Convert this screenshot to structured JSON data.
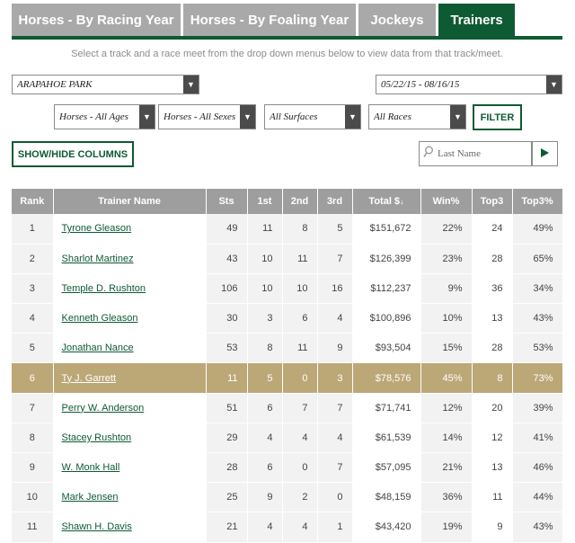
{
  "tabs": [
    {
      "label": "Horses - By Racing Year",
      "active": false
    },
    {
      "label": "Horses - By Foaling Year",
      "active": false
    },
    {
      "label": "Jockeys",
      "active": false
    },
    {
      "label": "Trainers",
      "active": true
    }
  ],
  "instructions": "Select a track and a race meet from the drop down menus below to view data from that track/meet.",
  "filters": {
    "track": "ARAPAHOE PARK",
    "meet": "05/22/15 - 08/16/15",
    "ages": "Horses - All Ages",
    "sexes": "Horses - All Sexes",
    "surfaces": "All Surfaces",
    "races": "All Races",
    "filter_label": "FILTER"
  },
  "show_hide_label": "SHOW/HIDE COLUMNS",
  "search": {
    "placeholder": "Last Name"
  },
  "table": {
    "headers": [
      "Rank",
      "Trainer Name",
      "Sts",
      "1st",
      "2nd",
      "3rd",
      "Total $",
      "Win%",
      "Top3",
      "Top3%"
    ],
    "sort_indicator": "↓",
    "rows": [
      {
        "rank": "1",
        "name": "Tyrone Gleason",
        "sts": "49",
        "first": "11",
        "second": "8",
        "third": "5",
        "total": "$151,672",
        "win": "22%",
        "top3": "24",
        "top3pct": "49%"
      },
      {
        "rank": "2",
        "name": "Sharlot Martinez",
        "sts": "43",
        "first": "10",
        "second": "11",
        "third": "7",
        "total": "$126,399",
        "win": "23%",
        "top3": "28",
        "top3pct": "65%"
      },
      {
        "rank": "3",
        "name": "Temple D. Rushton",
        "sts": "106",
        "first": "10",
        "second": "10",
        "third": "16",
        "total": "$112,237",
        "win": "9%",
        "top3": "36",
        "top3pct": "34%"
      },
      {
        "rank": "4",
        "name": "Kenneth Gleason",
        "sts": "30",
        "first": "3",
        "second": "6",
        "third": "4",
        "total": "$100,896",
        "win": "10%",
        "top3": "13",
        "top3pct": "43%"
      },
      {
        "rank": "5",
        "name": "Jonathan Nance",
        "sts": "53",
        "first": "8",
        "second": "11",
        "third": "9",
        "total": "$93,504",
        "win": "15%",
        "top3": "28",
        "top3pct": "53%"
      },
      {
        "rank": "6",
        "name": "Ty J. Garrett",
        "sts": "11",
        "first": "5",
        "second": "0",
        "third": "3",
        "total": "$78,576",
        "win": "45%",
        "top3": "8",
        "top3pct": "73%",
        "highlight": true
      },
      {
        "rank": "7",
        "name": "Perry W. Anderson",
        "sts": "51",
        "first": "6",
        "second": "7",
        "third": "7",
        "total": "$71,741",
        "win": "12%",
        "top3": "20",
        "top3pct": "39%"
      },
      {
        "rank": "8",
        "name": "Stacey Rushton",
        "sts": "29",
        "first": "4",
        "second": "4",
        "third": "4",
        "total": "$61,539",
        "win": "14%",
        "top3": "12",
        "top3pct": "41%"
      },
      {
        "rank": "9",
        "name": "W. Monk Hall",
        "sts": "28",
        "first": "6",
        "second": "0",
        "third": "7",
        "total": "$57,095",
        "win": "21%",
        "top3": "13",
        "top3pct": "46%"
      },
      {
        "rank": "10",
        "name": "Mark Jensen",
        "sts": "25",
        "first": "9",
        "second": "2",
        "third": "0",
        "total": "$48,159",
        "win": "36%",
        "top3": "11",
        "top3pct": "44%"
      },
      {
        "rank": "11",
        "name": "Shawn H. Davis",
        "sts": "21",
        "first": "4",
        "second": "4",
        "third": "1",
        "total": "$43,420",
        "win": "19%",
        "top3": "9",
        "top3pct": "43%"
      }
    ]
  },
  "colors": {
    "brand_green": "#0e5a33",
    "highlight_gold": "#bca777",
    "tab_gray": "#a9a9a9",
    "header_gray": "#9e9e9e"
  },
  "icons": {
    "dropdown": "triangle-down-icon",
    "search": "magnifier-icon",
    "go": "play-triangle-icon"
  }
}
